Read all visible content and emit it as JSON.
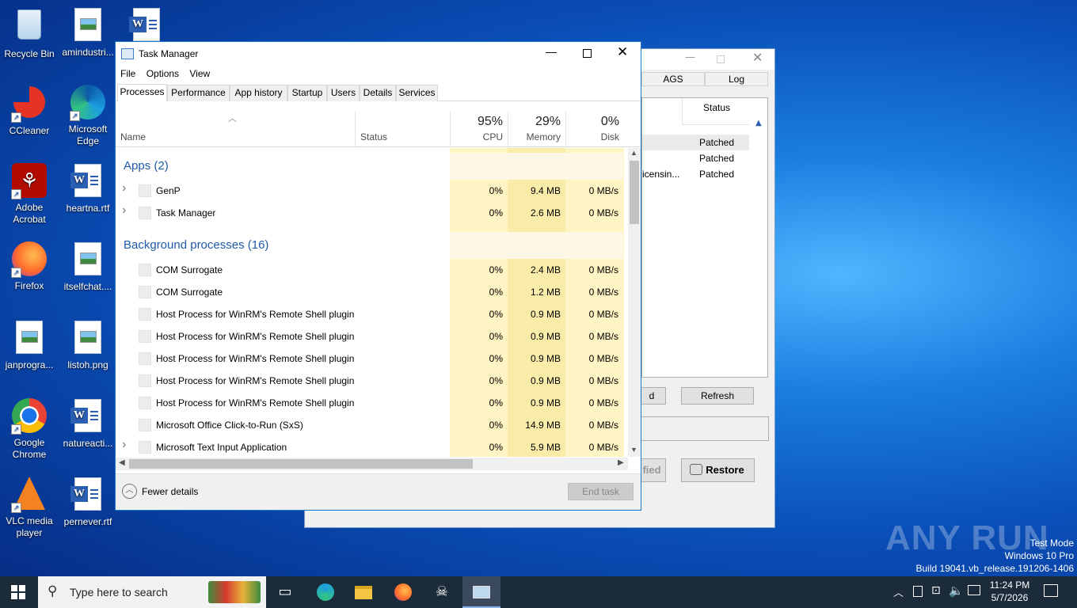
{
  "desktop": {
    "icons": [
      {
        "label": "Recycle Bin",
        "icon": "recycle-bin-icon"
      },
      {
        "label": "amindustri...",
        "icon": "image-file-icon"
      },
      {
        "label": "",
        "icon": "word-document-icon"
      },
      {
        "label": "CCleaner",
        "icon": "ccleaner-icon"
      },
      {
        "label": "Microsoft Edge",
        "icon": "edge-icon"
      },
      {
        "label": "Adobe Acrobat",
        "icon": "acrobat-icon"
      },
      {
        "label": "heartna.rtf",
        "icon": "word-document-icon"
      },
      {
        "label": "Firefox",
        "icon": "firefox-icon"
      },
      {
        "label": "itselfchat....",
        "icon": "image-file-icon"
      },
      {
        "label": "janprogra...",
        "icon": "image-file-icon"
      },
      {
        "label": "listoh.png",
        "icon": "image-file-icon"
      },
      {
        "label": "Google Chrome",
        "icon": "chrome-icon"
      },
      {
        "label": "natureacti...",
        "icon": "word-document-icon"
      },
      {
        "label": "VLC media player",
        "icon": "vlc-icon"
      },
      {
        "label": "pernever.rtf",
        "icon": "word-document-icon"
      }
    ]
  },
  "patcher": {
    "tabs": [
      "AGS",
      "Log"
    ],
    "status_header": "Status",
    "rows": [
      {
        "name": "",
        "status": "Patched"
      },
      {
        "name": "",
        "status": "Patched"
      },
      {
        "name": "icensin...",
        "status": "Patched"
      }
    ],
    "btn_partial": "d",
    "refresh": "Refresh",
    "btn_partial2": "fied",
    "restore": "Restore"
  },
  "taskmanager": {
    "title": "Task Manager",
    "menu": [
      "File",
      "Options",
      "View"
    ],
    "tabs": [
      "Processes",
      "Performance",
      "App history",
      "Startup",
      "Users",
      "Details",
      "Services"
    ],
    "columns": {
      "name": "Name",
      "status": "Status",
      "cpu_pct": "95%",
      "cpu": "CPU",
      "mem_pct": "29%",
      "mem": "Memory",
      "disk_pct": "0%",
      "disk": "Disk"
    },
    "groups": {
      "apps": "Apps (2)",
      "background": "Background processes (16)"
    },
    "apps": [
      {
        "name": "GenP",
        "cpu": "0%",
        "mem": "9.4 MB",
        "disk": "0 MB/s",
        "expand": true
      },
      {
        "name": "Task Manager",
        "cpu": "0%",
        "mem": "2.6 MB",
        "disk": "0 MB/s",
        "expand": true
      }
    ],
    "background": [
      {
        "name": "COM Surrogate",
        "cpu": "0%",
        "mem": "2.4 MB",
        "disk": "0 MB/s",
        "expand": false
      },
      {
        "name": "COM Surrogate",
        "cpu": "0%",
        "mem": "1.2 MB",
        "disk": "0 MB/s",
        "expand": false
      },
      {
        "name": "Host Process for WinRM's Remote Shell plugin",
        "cpu": "0%",
        "mem": "0.9 MB",
        "disk": "0 MB/s",
        "expand": false
      },
      {
        "name": "Host Process for WinRM's Remote Shell plugin",
        "cpu": "0%",
        "mem": "0.9 MB",
        "disk": "0 MB/s",
        "expand": false
      },
      {
        "name": "Host Process for WinRM's Remote Shell plugin",
        "cpu": "0%",
        "mem": "0.9 MB",
        "disk": "0 MB/s",
        "expand": false
      },
      {
        "name": "Host Process for WinRM's Remote Shell plugin",
        "cpu": "0%",
        "mem": "0.9 MB",
        "disk": "0 MB/s",
        "expand": false
      },
      {
        "name": "Host Process for WinRM's Remote Shell plugin",
        "cpu": "0%",
        "mem": "0.9 MB",
        "disk": "0 MB/s",
        "expand": false
      },
      {
        "name": "Microsoft Office Click-to-Run (SxS)",
        "cpu": "0%",
        "mem": "14.9 MB",
        "disk": "0 MB/s",
        "expand": false
      },
      {
        "name": "Microsoft Text Input Application",
        "cpu": "0%",
        "mem": "5.9 MB",
        "disk": "0 MB/s",
        "expand": true
      }
    ],
    "fewer_details": "Fewer details",
    "end_task": "End task"
  },
  "watermark": {
    "brand": "ANY RUN",
    "line1": "Test Mode",
    "line2": "Windows 10 Pro",
    "line3": "Build 19041.vb_release.191206-1406"
  },
  "taskbar": {
    "search_placeholder": "Type here to search",
    "time": "11:24 PM",
    "date": "5/7/2026"
  }
}
